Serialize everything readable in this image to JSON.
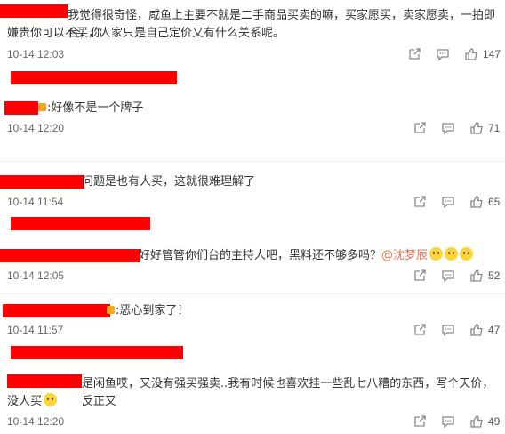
{
  "icons": [
    "share-icon",
    "comment-icon",
    "like-icon"
  ],
  "comments": [
    {
      "text_1": "我觉得很奇怪，咸鱼上主要不就是二手商品买卖的嘛，买家愿买，卖家愿卖，一拍即合，你",
      "text_2": "嫌贵你可以不买，人家只是自己定价又有什么关系呢。",
      "time": "10-14 12:03",
      "likes": "147"
    },
    {
      "text_1": ":好像不是一个牌子",
      "time": "10-14 12:20",
      "likes": "71"
    },
    {
      "text_1": "问题是也有人买，这就很难理解了",
      "time": "10-14 11:54",
      "likes": "65"
    },
    {
      "text_1": "好好管管你们台的主持人吧，黑料还不够多吗？",
      "mention": "@沈梦辰",
      "time": "10-14 12:05",
      "likes": "52"
    },
    {
      "text_1": ":恶心到家了！",
      "time": "10-14 11:57",
      "likes": "47"
    },
    {
      "text_1": "是闲鱼哎，又没有强买强卖..我有时候也喜欢挂一些乱七八糟的东西，写个天价，反正又",
      "text_2": "没人买",
      "time": "10-14 12:20",
      "likes": "49"
    }
  ]
}
